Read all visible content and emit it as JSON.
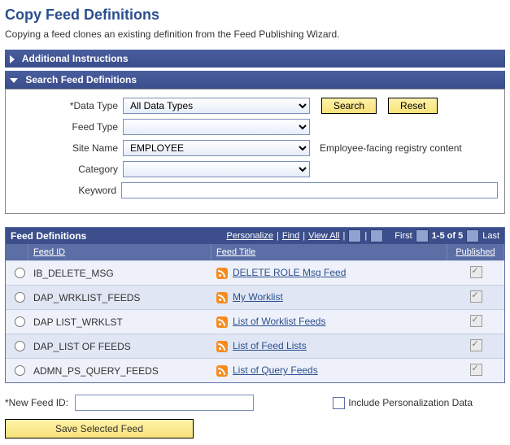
{
  "page": {
    "title": "Copy Feed Definitions",
    "subtitle": "Copying a feed clones an existing definition from the Feed Publishing Wizard."
  },
  "sections": {
    "instructions": "Additional Instructions",
    "search": "Search Feed Definitions"
  },
  "search": {
    "labels": {
      "data_type": "Data Type",
      "feed_type": "Feed Type",
      "site_name": "Site Name",
      "category": "Category",
      "keyword": "Keyword"
    },
    "values": {
      "data_type": "All Data Types",
      "feed_type": "",
      "site_name": "EMPLOYEE",
      "category": "",
      "keyword": ""
    },
    "hint": "Employee-facing registry content",
    "buttons": {
      "search": "Search",
      "reset": "Reset"
    }
  },
  "grid": {
    "title": "Feed Definitions",
    "tools": {
      "personalize": "Personalize",
      "find": "Find",
      "view_all": "View All",
      "first": "First",
      "range": "1-5 of 5",
      "last": "Last"
    },
    "columns": {
      "feed_id": "Feed ID",
      "feed_title": "Feed Title",
      "published": "Published"
    },
    "rows": [
      {
        "id": "IB_DELETE_MSG",
        "title": "DELETE  ROLE Msg Feed",
        "published": true
      },
      {
        "id": "DAP_WRKLIST_FEEDS",
        "title": "My Worklist",
        "published": true
      },
      {
        "id": "DAP LIST_WRKLST",
        "title": "List of Worklist Feeds",
        "published": true
      },
      {
        "id": "DAP_LIST OF FEEDS",
        "title": "List of Feed Lists",
        "published": true
      },
      {
        "id": "ADMN_PS_QUERY_FEEDS",
        "title": "List of Query Feeds",
        "published": true
      }
    ]
  },
  "footer": {
    "new_feed_label": "New Feed ID:",
    "new_feed_value": "",
    "include_label": "Include Personalization Data",
    "save_label": "Save Selected Feed"
  }
}
